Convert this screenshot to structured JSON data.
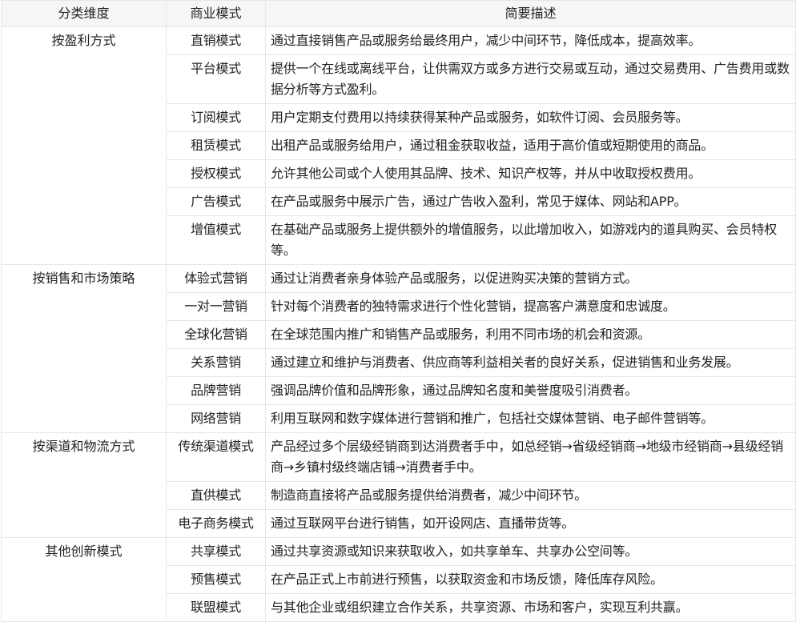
{
  "headers": [
    "分类维度",
    "商业模式",
    "简要描述"
  ],
  "groups": [
    {
      "dimension": "按盈利方式",
      "rows": [
        {
          "mode": "直销模式",
          "desc": "通过直接销售产品或服务给最终用户，减少中间环节，降低成本，提高效率。"
        },
        {
          "mode": "平台模式",
          "desc": "提供一个在线或离线平台，让供需双方或多方进行交易或互动，通过交易费用、广告费用或数据分析等方式盈利。"
        },
        {
          "mode": "订阅模式",
          "desc": "用户定期支付费用以持续获得某种产品或服务，如软件订阅、会员服务等。"
        },
        {
          "mode": "租赁模式",
          "desc": "出租产品或服务给用户，通过租金获取收益，适用于高价值或短期使用的商品。"
        },
        {
          "mode": "授权模式",
          "desc": "允许其他公司或个人使用其品牌、技术、知识产权等，并从中收取授权费用。"
        },
        {
          "mode": "广告模式",
          "desc": "在产品或服务中展示广告，通过广告收入盈利，常见于媒体、网站和APP。"
        },
        {
          "mode": "增值模式",
          "desc": "在基础产品或服务上提供额外的增值服务，以此增加收入，如游戏内的道具购买、会员特权等。"
        }
      ]
    },
    {
      "dimension": "按销售和市场策略",
      "rows": [
        {
          "mode": "体验式营销",
          "desc": "通过让消费者亲身体验产品或服务，以促进购买决策的营销方式。"
        },
        {
          "mode": "一对一营销",
          "desc": "针对每个消费者的独特需求进行个性化营销，提高客户满意度和忠诚度。"
        },
        {
          "mode": "全球化营销",
          "desc": "在全球范围内推广和销售产品或服务，利用不同市场的机会和资源。"
        },
        {
          "mode": "关系营销",
          "desc": "通过建立和维护与消费者、供应商等利益相关者的良好关系，促进销售和业务发展。"
        },
        {
          "mode": "品牌营销",
          "desc": "强调品牌价值和品牌形象，通过品牌知名度和美誉度吸引消费者。"
        },
        {
          "mode": "网络营销",
          "desc": "利用互联网和数字媒体进行营销和推广，包括社交媒体营销、电子邮件营销等。"
        }
      ]
    },
    {
      "dimension": "按渠道和物流方式",
      "rows": [
        {
          "mode": "传统渠道模式",
          "desc": "产品经过多个层级经销商到达消费者手中，如总经销→省级经销商→地级市经销商→县级经销商→乡镇村级终端店铺→消费者手中。"
        },
        {
          "mode": "直供模式",
          "desc": "制造商直接将产品或服务提供给消费者，减少中间环节。"
        },
        {
          "mode": "电子商务模式",
          "desc": "通过互联网平台进行销售，如开设网店、直播带货等。"
        }
      ]
    },
    {
      "dimension": "其他创新模式",
      "rows": [
        {
          "mode": "共享模式",
          "desc": "通过共享资源或知识来获取收入，如共享单车、共享办公空间等。"
        },
        {
          "mode": "预售模式",
          "desc": "在产品正式上市前进行预售，以获取资金和市场反馈，降低库存风险。"
        },
        {
          "mode": "联盟模式",
          "desc": "与其他企业或组织建立合作关系，共享资源、市场和客户，实现互利共赢。"
        }
      ]
    }
  ]
}
